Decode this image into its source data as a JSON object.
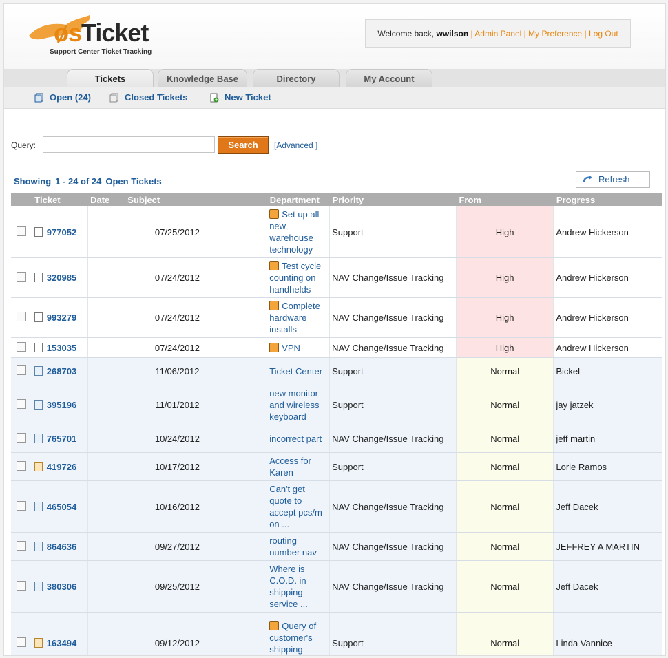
{
  "header": {
    "logo_text_os": "os",
    "logo_text_ticket": "Ticket",
    "logo_tagline": "Support Center Ticket Tracking",
    "welcome_prefix": "Welcome back, ",
    "username": "wwilson",
    "links": [
      "Admin Panel",
      "My Preference",
      "Log Out"
    ]
  },
  "tabs": [
    {
      "label": "Tickets",
      "active": true
    },
    {
      "label": "Knowledge Base",
      "active": false
    },
    {
      "label": "Directory",
      "active": false
    },
    {
      "label": "My Account",
      "active": false
    }
  ],
  "subnav": {
    "open": "Open (24)",
    "closed": "Closed Tickets",
    "new": "New Ticket"
  },
  "query": {
    "label": "Query:",
    "value": "",
    "button": "Search",
    "advanced": "[Advanced ]"
  },
  "showing": {
    "prefix": "Showing",
    "range": "1 - 24 of 24",
    "suffix": "Open Tickets"
  },
  "refresh_label": "Refresh",
  "columns": [
    "Ticket",
    "Date",
    "Subject",
    "Department",
    "Priority",
    "From",
    "Progress"
  ],
  "rows": [
    {
      "ticket": "977052",
      "date": "07/25/2012",
      "subject": "Set up all new warehouse technology",
      "dept": "Support",
      "priority": "High",
      "from": "Andrew Hickerson",
      "attach": true,
      "icon": "doc"
    },
    {
      "ticket": "320985",
      "date": "07/24/2012",
      "subject": "Test cycle counting on handhelds",
      "dept": "NAV Change/Issue Tracking",
      "priority": "High",
      "from": "Andrew Hickerson",
      "attach": true,
      "icon": "doc"
    },
    {
      "ticket": "993279",
      "date": "07/24/2012",
      "subject": "Complete hardware installs",
      "dept": "NAV Change/Issue Tracking",
      "priority": "High",
      "from": "Andrew Hickerson",
      "attach": true,
      "icon": "doc"
    },
    {
      "ticket": "153035",
      "date": "07/24/2012",
      "subject": "VPN",
      "dept": "NAV Change/Issue Tracking",
      "priority": "High",
      "from": "Andrew Hickerson",
      "attach": true,
      "icon": "doc"
    },
    {
      "ticket": "268703",
      "date": "11/06/2012",
      "subject": "Ticket Center",
      "dept": "Support",
      "priority": "Normal",
      "from": "Bickel",
      "attach": false,
      "icon": "blue"
    },
    {
      "ticket": "395196",
      "date": "11/01/2012",
      "subject": "new monitor and wireless keyboard",
      "dept": "Support",
      "priority": "Normal",
      "from": "jay jatzek",
      "attach": false,
      "icon": "blue"
    },
    {
      "ticket": "765701",
      "date": "10/24/2012",
      "subject": "incorrect part",
      "dept": "NAV Change/Issue Tracking",
      "priority": "Normal",
      "from": "jeff martin",
      "attach": false,
      "icon": "blue"
    },
    {
      "ticket": "419726",
      "date": "10/17/2012",
      "subject": "Access for Karen",
      "dept": "Support",
      "priority": "Normal",
      "from": "Lorie Ramos",
      "attach": false,
      "icon": "orange"
    },
    {
      "ticket": "465054",
      "date": "10/16/2012",
      "subject": "Can't get quote to accept pcs/m on ...",
      "dept": "NAV Change/Issue Tracking",
      "priority": "Normal",
      "from": "Jeff Dacek",
      "attach": false,
      "icon": "blue"
    },
    {
      "ticket": "864636",
      "date": "09/27/2012",
      "subject": "routing number nav",
      "dept": "NAV Change/Issue Tracking",
      "priority": "Normal",
      "from": "JEFFREY A MARTIN",
      "attach": false,
      "icon": "blue"
    },
    {
      "ticket": "380306",
      "date": "09/25/2012",
      "subject": "Where is C.O.D. in shipping service ...",
      "dept": "NAV Change/Issue Tracking",
      "priority": "Normal",
      "from": "Jeff Dacek",
      "attach": false,
      "icon": "blue"
    },
    {
      "ticket": "163494",
      "date": "09/12/2012",
      "subject": "Query of customer's shipping methods",
      "dept": "Support",
      "priority": "Normal",
      "from": "Linda Vannice",
      "attach": true,
      "icon": "orange"
    }
  ]
}
